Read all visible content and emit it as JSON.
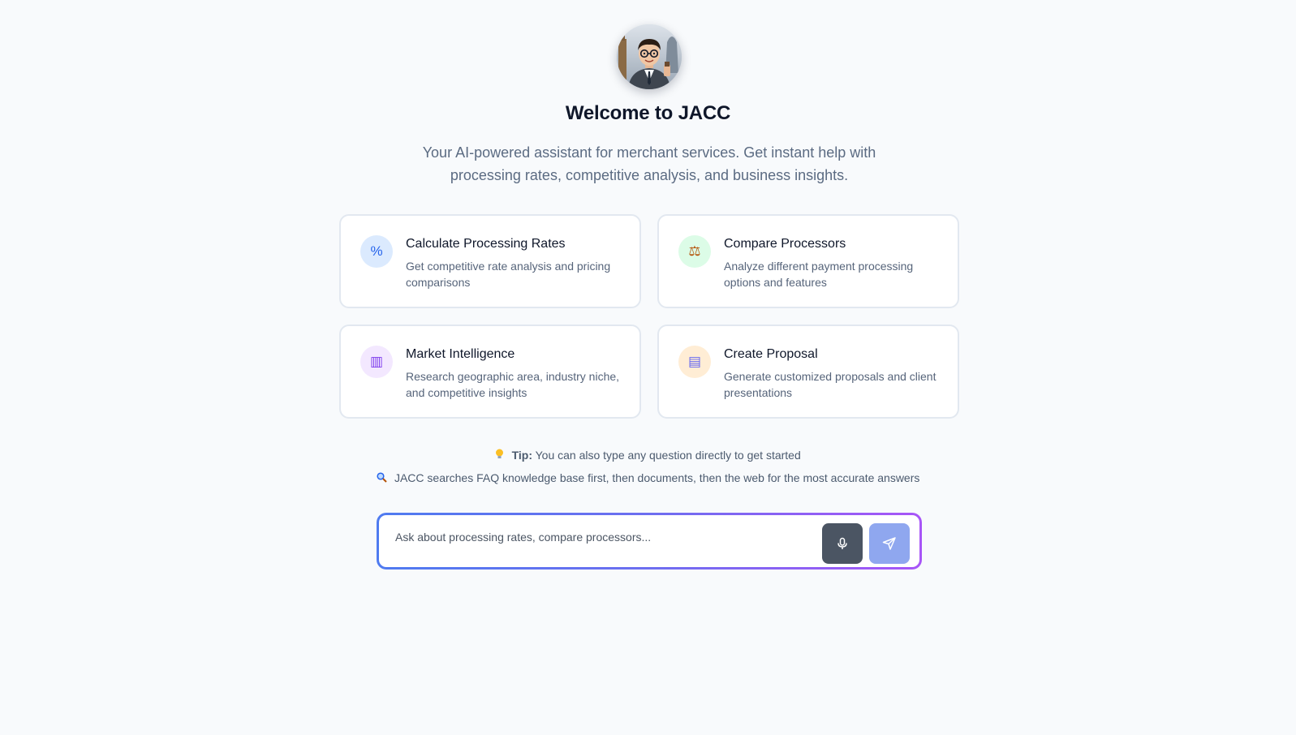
{
  "header": {
    "title": "Welcome to JACC",
    "subtitle": "Your AI-powered assistant for merchant services. Get instant help with processing rates, competitive analysis, and business insights."
  },
  "cards": [
    {
      "icon": "percent-icon",
      "glyph": "%",
      "icon_bg": "#dbeafe",
      "icon_color": "#2563eb",
      "title": "Calculate Processing Rates",
      "description": "Get competitive rate analysis and pricing comparisons"
    },
    {
      "icon": "scales-icon",
      "glyph": "⚖",
      "icon_bg": "#dcfce7",
      "icon_color": "#b45309",
      "title": "Compare Processors",
      "description": "Analyze different payment processing options and features"
    },
    {
      "icon": "bar-chart-icon",
      "glyph": "▥",
      "icon_bg": "#f3e8ff",
      "icon_color": "#7c3aed",
      "title": "Market Intelligence",
      "description": "Research geographic area, industry niche, and competitive insights"
    },
    {
      "icon": "document-icon",
      "glyph": "▤",
      "icon_bg": "#ffedd5",
      "icon_color": "#6366f1",
      "title": "Create Proposal",
      "description": "Generate customized proposals and client presentations"
    }
  ],
  "tips": {
    "tip_label": "Tip:",
    "tip_text": " You can also type any question directly to get started",
    "search_text": "JACC searches FAQ knowledge base first, then documents, then the web for the most accurate answers"
  },
  "composer": {
    "placeholder": "Ask about processing rates, compare processors...",
    "value": ""
  },
  "colors": {
    "accent_start": "#4f7bf0",
    "accent_end": "#a855f7",
    "mic_button": "#4b5563",
    "send_button": "#8fa7ef"
  }
}
